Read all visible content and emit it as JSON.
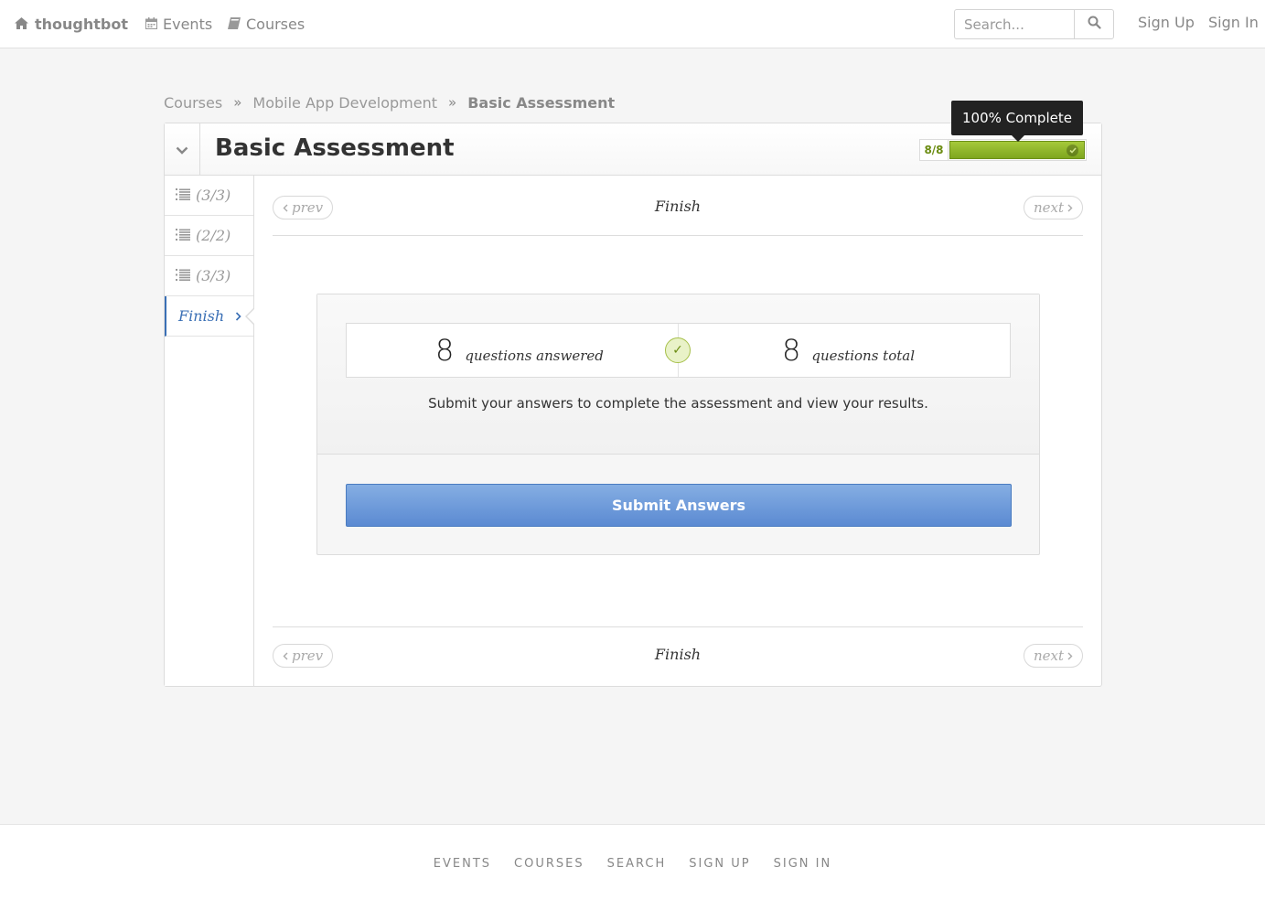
{
  "topnav": {
    "brand": "thoughtbot",
    "events": "Events",
    "courses": "Courses",
    "search_placeholder": "Search...",
    "sign_up": "Sign Up",
    "sign_in": "Sign In"
  },
  "breadcrumb": {
    "items": [
      "Courses",
      "Mobile App Development"
    ],
    "current": "Basic Assessment"
  },
  "assessment": {
    "title": "Basic Assessment",
    "progress_count": "8/8",
    "progress_percent": 100,
    "progress_tooltip": "100% Complete"
  },
  "sidebar": {
    "items": [
      {
        "label": "(3/3)",
        "icon": "list-icon"
      },
      {
        "label": "(2/2)",
        "icon": "list-icon"
      },
      {
        "label": "(3/3)",
        "icon": "list-icon"
      },
      {
        "label": "Finish",
        "icon": "chevron-right-icon"
      }
    ]
  },
  "pager": {
    "prev": "prev",
    "next": "next",
    "title": "Finish"
  },
  "summary": {
    "answered_count": "8",
    "answered_label": "questions answered",
    "total_count": "8",
    "total_label": "questions total",
    "message": "Submit your answers to complete the assessment and view your results.",
    "submit_label": "Submit Answers"
  },
  "footer": {
    "links": [
      "EVENTS",
      "COURSES",
      "SEARCH",
      "SIGN UP",
      "SIGN IN"
    ]
  },
  "colors": {
    "accent_blue": "#5b8ad2",
    "progress_green": "#8fb52a",
    "link_blue": "#3a6fb5"
  }
}
